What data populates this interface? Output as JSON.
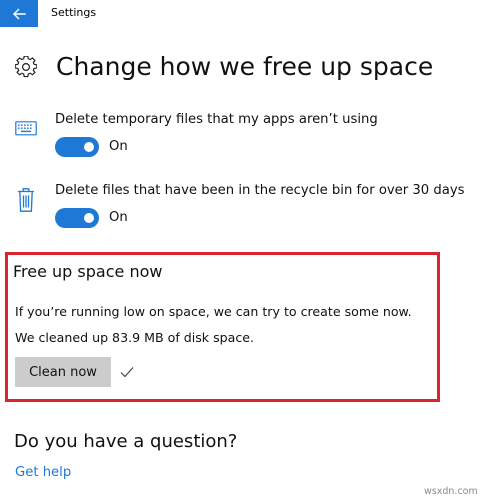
{
  "window": {
    "title": "Settings"
  },
  "header": {
    "title": "Change how we free up space",
    "icon": "gear-icon"
  },
  "options": [
    {
      "icon": "keyboard-icon",
      "label": "Delete temporary files that my apps aren’t using",
      "toggle_state": "On",
      "enabled": true
    },
    {
      "icon": "trash-icon",
      "label": "Delete files that have been in the recycle bin for over 30 days",
      "toggle_state": "On",
      "enabled": true
    }
  ],
  "free_up": {
    "title": "Free up space now",
    "description": "If you’re running low on space, we can try to create some now.",
    "status": "We cleaned up 83.9 MB of disk space.",
    "button_label": "Clean now",
    "status_icon": "checkmark-icon"
  },
  "question": {
    "title": "Do you have a question?",
    "link": "Get help"
  },
  "watermark": "wsxdn.com",
  "colors": {
    "accent": "#1e78d6",
    "highlight_border": "#d9252f",
    "button_bg": "#cccccc"
  }
}
